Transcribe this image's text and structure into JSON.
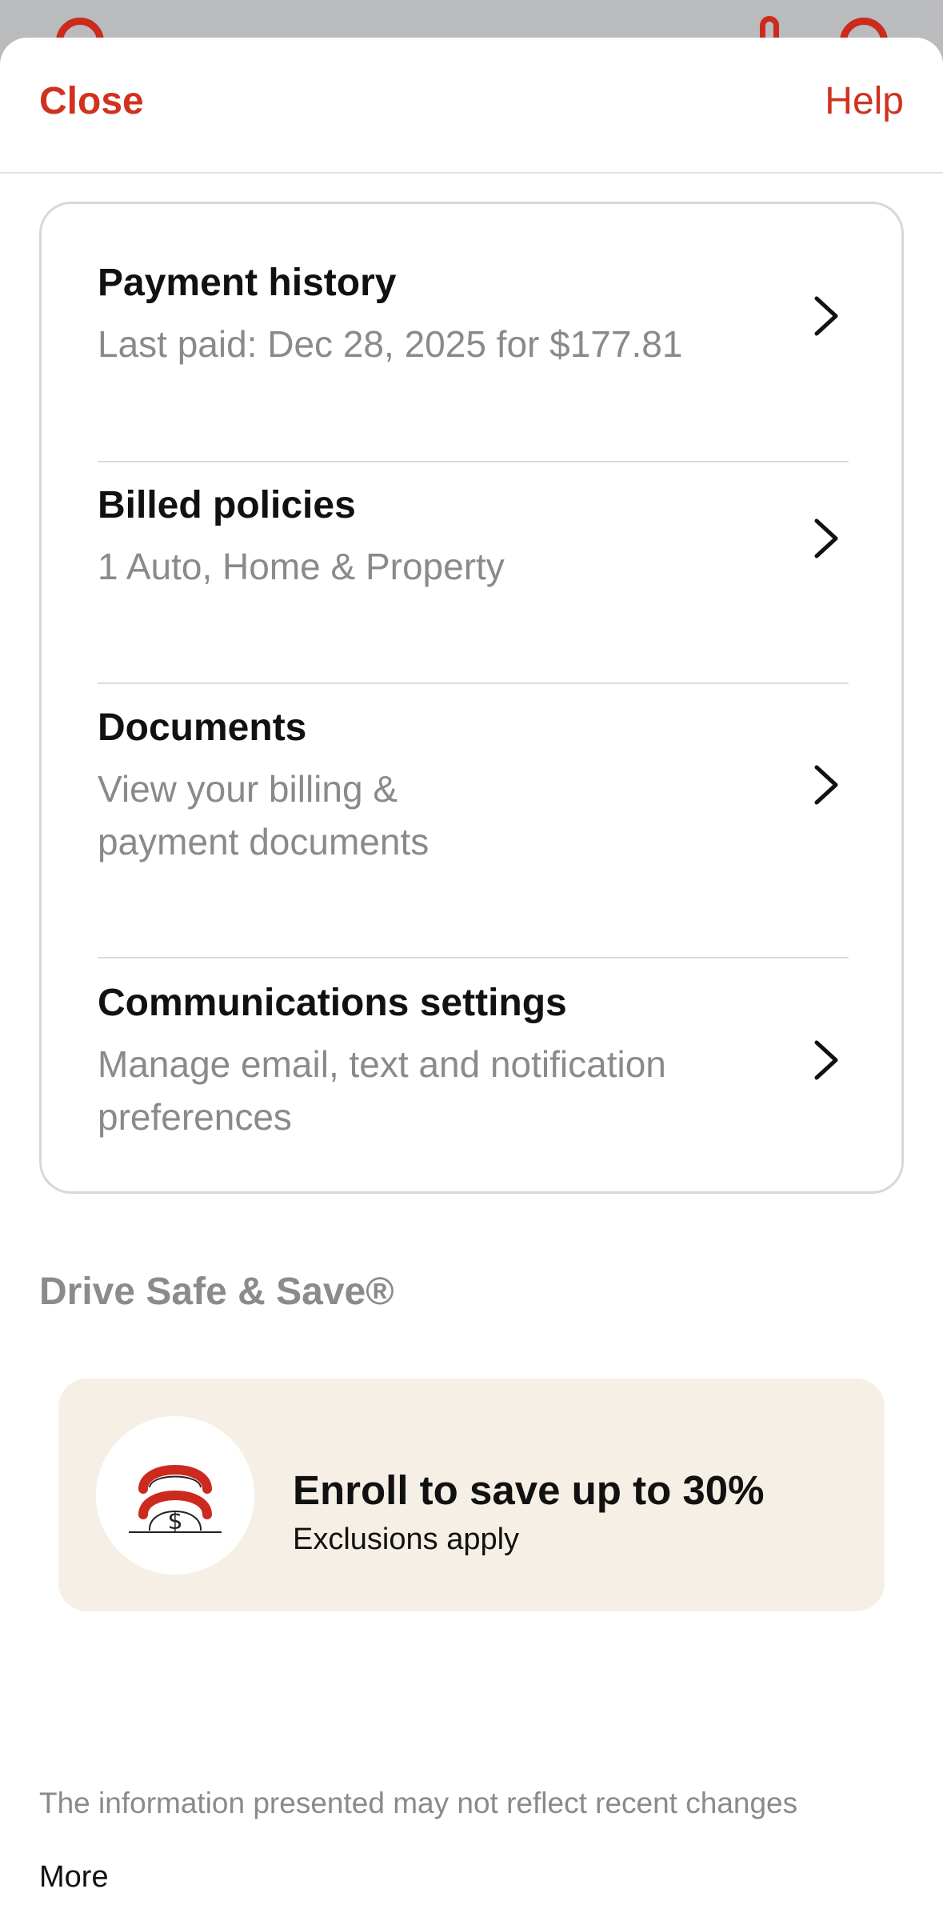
{
  "header": {
    "close_label": "Close",
    "help_label": "Help"
  },
  "menu": {
    "items": [
      {
        "title": "Payment history",
        "subtitle": "Last paid: Dec 28, 2025 for $177.81"
      },
      {
        "title": "Billed policies",
        "subtitle": "1 Auto, Home & Property"
      },
      {
        "title": "Documents",
        "subtitle": "View your billing & payment documents"
      },
      {
        "title": "Communications settings",
        "subtitle": "Manage email, text and notification preferences"
      }
    ]
  },
  "drive_safe": {
    "section_title": "Drive Safe & Save®",
    "promo_title": "Enroll to save up to 30%",
    "promo_subtitle": "Exclusions apply"
  },
  "footer": {
    "disclaimer": "The information presented may not reflect recent changes",
    "more_label": "More"
  },
  "colors": {
    "accent": "#d0321f",
    "promo_bg": "#f6efe5",
    "muted_text": "#8a8a8a"
  }
}
